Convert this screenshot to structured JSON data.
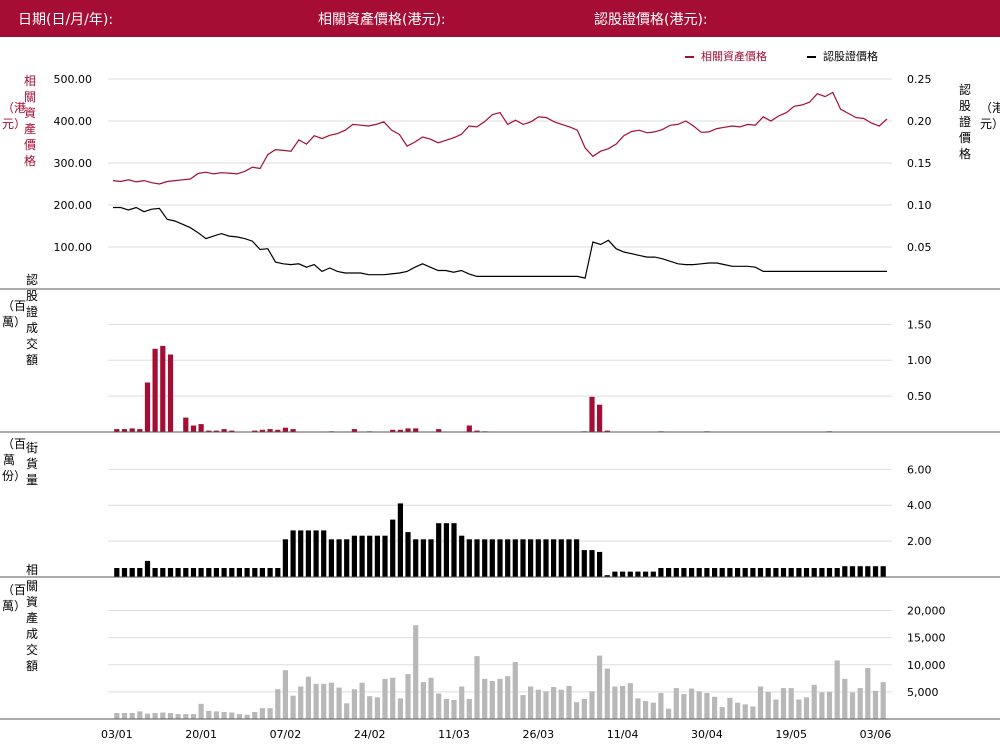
{
  "header": {
    "date_label": "日期(日/月/年):",
    "asset_price_label": "相關資產價格(港元):",
    "warrant_price_label": "認股證價格(港元):"
  },
  "colors": {
    "header_bg": "#a50d34",
    "asset": "#a50d34",
    "warrant": "#000000",
    "turnover_bar": "#a50d34",
    "street_bar": "#000000",
    "asset_turnover_bar": "#b8b8b8",
    "grid": "#dddddd"
  },
  "chart_data": [
    {
      "type": "line",
      "panel": "price",
      "legend": [
        "相關資產價格",
        "認股證價格"
      ],
      "legend_position": "top-right",
      "ylabel_left": "相關資產價格",
      "ylabel_left_unit": "（港元）",
      "ylabel_right": "認股證價格",
      "ylabel_right_unit": "（港元）",
      "yticks_left": [
        "100.00",
        "200.00",
        "300.00",
        "400.00",
        "500.00"
      ],
      "yticks_left_values": [
        100,
        200,
        300,
        400,
        500
      ],
      "yticks_right": [
        "0.05",
        "0.10",
        "0.15",
        "0.20",
        "0.25"
      ],
      "yticks_right_values": [
        0.05,
        0.1,
        0.15,
        0.2,
        0.25
      ],
      "ylim_left": [
        0,
        500
      ],
      "ylim_right": [
        0,
        0.25
      ],
      "series": [
        {
          "name": "相關資產價格",
          "axis": "left",
          "values": [
            258,
            256,
            260,
            255,
            258,
            253,
            250,
            256,
            258,
            260,
            262,
            275,
            278,
            274,
            277,
            276,
            274,
            280,
            290,
            287,
            320,
            332,
            330,
            328,
            355,
            345,
            365,
            358,
            366,
            370,
            378,
            392,
            390,
            388,
            392,
            398,
            378,
            368,
            340,
            350,
            362,
            357,
            348,
            354,
            360,
            368,
            388,
            386,
            398,
            415,
            420,
            392,
            402,
            392,
            398,
            410,
            408,
            398,
            392,
            386,
            378,
            336,
            316,
            328,
            334,
            345,
            365,
            375,
            378,
            372,
            374,
            380,
            390,
            392,
            400,
            388,
            373,
            374,
            382,
            385,
            388,
            386,
            392,
            390,
            410,
            400,
            412,
            420,
            435,
            438,
            445,
            465,
            458,
            468,
            428,
            418,
            408,
            406,
            395,
            388,
            405
          ]
        },
        {
          "name": "認股證價格",
          "axis": "right",
          "values": [
            0.097,
            0.097,
            0.094,
            0.097,
            0.092,
            0.095,
            0.096,
            0.083,
            0.081,
            0.077,
            0.073,
            0.067,
            0.06,
            0.063,
            0.066,
            0.063,
            0.062,
            0.06,
            0.057,
            0.047,
            0.048,
            0.032,
            0.03,
            0.029,
            0.03,
            0.026,
            0.029,
            0.021,
            0.025,
            0.021,
            0.019,
            0.019,
            0.019,
            0.017,
            0.017,
            0.017,
            0.018,
            0.019,
            0.021,
            0.026,
            0.03,
            0.026,
            0.022,
            0.022,
            0.02,
            0.022,
            0.018,
            0.015,
            0.015,
            0.015,
            0.015,
            0.015,
            0.015,
            0.015,
            0.015,
            0.015,
            0.015,
            0.015,
            0.015,
            0.015,
            0.015,
            0.013,
            0.056,
            0.053,
            0.058,
            0.048,
            0.044,
            0.042,
            0.04,
            0.038,
            0.038,
            0.036,
            0.033,
            0.03,
            0.029,
            0.029,
            0.03,
            0.031,
            0.031,
            0.029,
            0.027,
            0.027,
            0.027,
            0.026,
            0.021,
            0.021,
            0.021,
            0.021,
            0.021,
            0.021,
            0.021,
            0.021,
            0.021,
            0.021,
            0.021,
            0.021,
            0.021,
            0.021,
            0.021,
            0.021,
            0.021
          ]
        }
      ]
    },
    {
      "type": "bar",
      "panel": "warrant_turnover",
      "ylabel": "認股證成交額",
      "ylabel_unit": "（百萬）",
      "yticks": [
        "0.50",
        "1.00",
        "1.50"
      ],
      "ytick_values": [
        0.5,
        1.0,
        1.5
      ],
      "ylim": [
        0,
        1.7
      ],
      "values": [
        0.04,
        0.04,
        0.05,
        0.04,
        0.69,
        1.16,
        1.2,
        1.08,
        0,
        0.2,
        0.09,
        0.11,
        0.02,
        0.02,
        0.04,
        0.02,
        0,
        0,
        0.02,
        0.03,
        0.04,
        0.03,
        0.06,
        0.04,
        0,
        0,
        0,
        0,
        0.01,
        0,
        0,
        0.04,
        0,
        0.01,
        0,
        0,
        0.03,
        0.03,
        0.05,
        0.05,
        0,
        0,
        0.04,
        0,
        0,
        0,
        0.09,
        0.02,
        0.01,
        0,
        0,
        0,
        0,
        0,
        0,
        0,
        0,
        0,
        0,
        0,
        0,
        0.01,
        0.49,
        0.38,
        0.02,
        0,
        0,
        0,
        0,
        0,
        0,
        0.01,
        0,
        0,
        0,
        0,
        0,
        0.01,
        0,
        0,
        0,
        0,
        0,
        0,
        0,
        0,
        0,
        0,
        0,
        0,
        0,
        0,
        0,
        0.01,
        0,
        0,
        0,
        0,
        0,
        0,
        0
      ]
    },
    {
      "type": "bar",
      "panel": "street",
      "ylabel": "街貨量",
      "ylabel_unit": "（百萬份）",
      "yticks": [
        "2.00",
        "4.00",
        "6.00"
      ],
      "ytick_values": [
        2,
        4,
        6
      ],
      "ylim": [
        0,
        6.8
      ],
      "values": [
        0.5,
        0.5,
        0.5,
        0.5,
        0.9,
        0.5,
        0.5,
        0.5,
        0.5,
        0.5,
        0.5,
        0.5,
        0.5,
        0.5,
        0.5,
        0.5,
        0.5,
        0.5,
        0.5,
        0.5,
        0.5,
        0.5,
        2.1,
        2.6,
        2.6,
        2.6,
        2.6,
        2.6,
        2.1,
        2.1,
        2.1,
        2.3,
        2.3,
        2.3,
        2.3,
        2.3,
        3.2,
        4.1,
        2.5,
        2.1,
        2.1,
        2.1,
        3.0,
        3.0,
        3.0,
        2.3,
        2.1,
        2.1,
        2.1,
        2.1,
        2.1,
        2.1,
        2.1,
        2.1,
        2.1,
        2.1,
        2.1,
        2.1,
        2.1,
        2.1,
        2.1,
        1.5,
        1.5,
        1.4,
        0.1,
        0.3,
        0.3,
        0.3,
        0.3,
        0.3,
        0.3,
        0.5,
        0.5,
        0.5,
        0.5,
        0.5,
        0.5,
        0.5,
        0.5,
        0.5,
        0.5,
        0.5,
        0.5,
        0.5,
        0.5,
        0.5,
        0.5,
        0.5,
        0.5,
        0.5,
        0.5,
        0.5,
        0.5,
        0.5,
        0.5,
        0.6,
        0.6,
        0.6,
        0.6,
        0.6,
        0.6
      ]
    },
    {
      "type": "bar",
      "panel": "asset_turnover",
      "ylabel": "相關資產成交額",
      "ylabel_unit": "（百萬）",
      "yticks": [
        "5,000",
        "10,000",
        "15,000",
        "20,000"
      ],
      "ytick_values": [
        5000,
        10000,
        15000,
        20000
      ],
      "ylim": [
        0,
        22500
      ],
      "values": [
        1100,
        1100,
        1100,
        1400,
        1000,
        1100,
        1200,
        1100,
        900,
        900,
        900,
        2800,
        1500,
        1400,
        1300,
        1200,
        900,
        800,
        1300,
        2000,
        2000,
        5500,
        9000,
        4300,
        6000,
        7800,
        6500,
        6500,
        6700,
        5800,
        2900,
        5500,
        6700,
        4200,
        4000,
        7400,
        7600,
        3800,
        8300,
        17300,
        6800,
        7600,
        4700,
        3700,
        3500,
        6000,
        3700,
        11600,
        7400,
        7000,
        7400,
        7900,
        10500,
        4400,
        6000,
        5400,
        5100,
        5900,
        5400,
        6100,
        3100,
        3700,
        5100,
        11700,
        9300,
        6000,
        6100,
        6600,
        3800,
        3300,
        3000,
        4800,
        1900,
        5700,
        4600,
        5600,
        5100,
        4800,
        4100,
        2200,
        3900,
        3000,
        2700,
        2300,
        6000,
        5000,
        3600,
        5700,
        5700,
        3600,
        4000,
        6300,
        4900,
        5000,
        10800,
        7400,
        4900,
        5700,
        9400,
        5200,
        6800
      ]
    }
  ],
  "x_axis": {
    "labels": [
      "03/01",
      "20/01",
      "07/02",
      "24/02",
      "11/03",
      "26/03",
      "11/04",
      "30/04",
      "19/05",
      "03/06"
    ],
    "label_indices": [
      0,
      11,
      22,
      33,
      44,
      55,
      66,
      77,
      88,
      99
    ]
  }
}
